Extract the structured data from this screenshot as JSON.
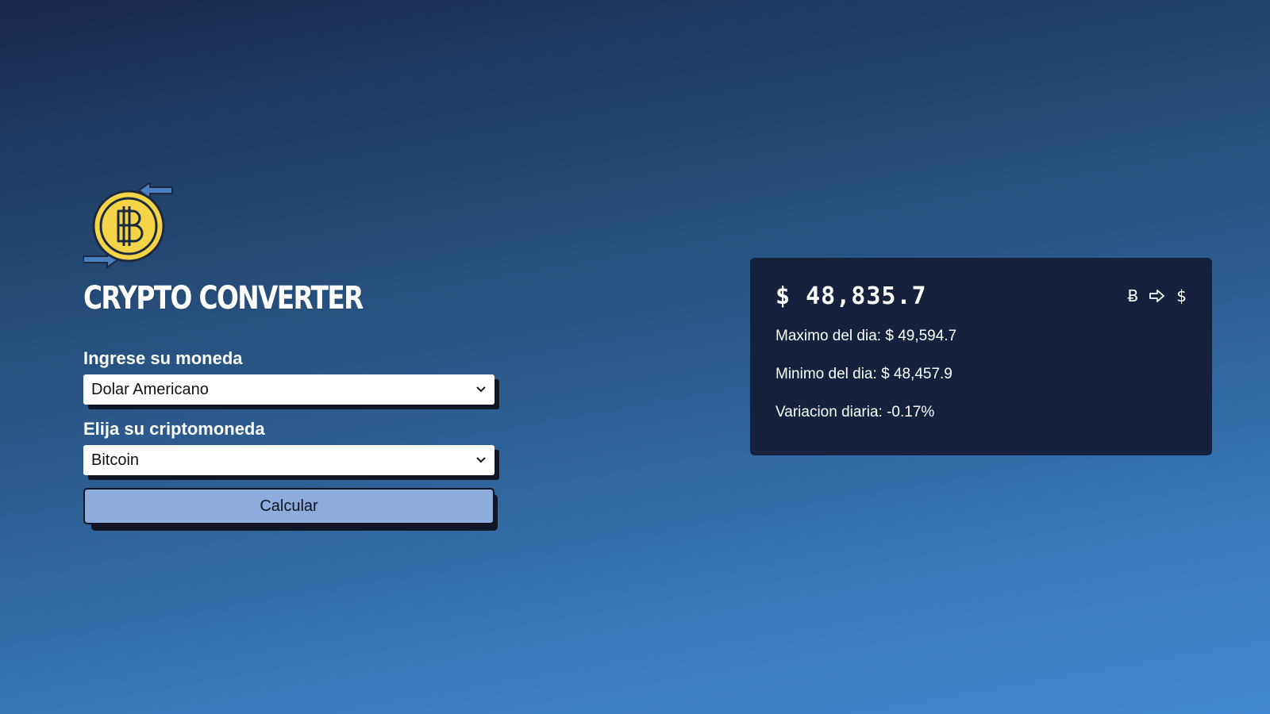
{
  "app": {
    "title": "CRYPTO CONVERTER",
    "logo_icon": "bitcoin-exchange-icon"
  },
  "form": {
    "currency_label": "Ingrese su moneda",
    "currency_value": "Dolar Americano",
    "crypto_label": "Elija su criptomoneda",
    "crypto_value": "Bitcoin",
    "calculate_label": "Calcular"
  },
  "result": {
    "price": "$ 48,835.7",
    "from_symbol": "Ƀ",
    "arrow_icon": "arrow-right-icon",
    "to_symbol": "$",
    "high_label": "Maximo del dia:",
    "high_value": "$ 49,594.7",
    "low_label": "Minimo del dia:",
    "low_value": "$ 48,457.9",
    "change_label": "Variacion diaria:",
    "change_value": "-0.17%"
  },
  "colors": {
    "background_top": "#18294a",
    "background_bottom": "#4189d2",
    "card": "#15213d",
    "button": "#8dabdc",
    "coin": "#f5d547",
    "arrow": "#4a7fc4"
  }
}
